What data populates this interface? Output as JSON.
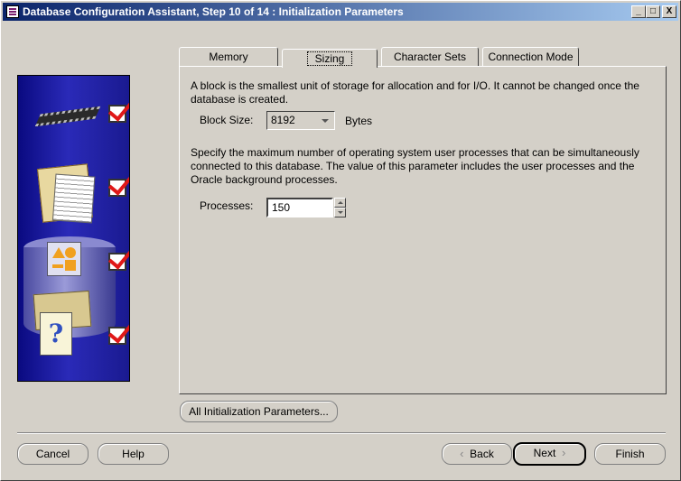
{
  "window": {
    "title": "Database Configuration Assistant, Step 10 of 14 : Initialization Parameters",
    "controls": [
      "_",
      "□",
      "X"
    ]
  },
  "tabs": [
    {
      "label": "Memory",
      "active": false
    },
    {
      "label": "Sizing",
      "active": true
    },
    {
      "label": "Character Sets",
      "active": false
    },
    {
      "label": "Connection Mode",
      "active": false
    }
  ],
  "sizing": {
    "block_description": "A block is the smallest unit of storage for allocation and for I/O. It cannot be changed once the database is created.",
    "block_size_label": "Block Size:",
    "block_size_value": "8192",
    "block_size_unit": "Bytes",
    "processes_description": "Specify the maximum number of operating system user processes that can be simultaneously connected to this database. The value of this parameter includes the user processes and the Oracle background processes.",
    "processes_label": "Processes:",
    "processes_value": "150"
  },
  "buttons": {
    "all_params": "All Initialization Parameters...",
    "cancel": "Cancel",
    "help": "Help",
    "back": "Back",
    "next": "Next",
    "finish": "Finish"
  },
  "graphic": {
    "icons": [
      "chip-icon",
      "documents-icon",
      "shapes-icon",
      "help-document-icon"
    ],
    "check_color": "#e01818"
  }
}
